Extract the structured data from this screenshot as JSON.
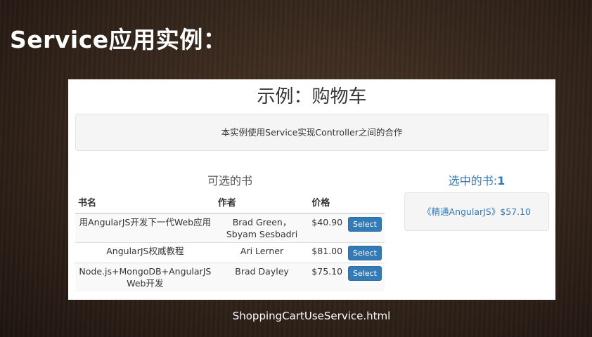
{
  "slide": {
    "title": "Service应用实例：",
    "caption": "ShoppingCartUseService.html"
  },
  "demo": {
    "title": "示例：购物车",
    "description": "本实例使用Service实现Controller之间的合作"
  },
  "available_books": {
    "title": "可选的书",
    "columns": [
      "书名",
      "作者",
      "价格"
    ],
    "button_label": "Select",
    "rows": [
      {
        "name": "用AngularJS开发下一代Web应用",
        "author": "Brad Green，Sbyam Sesbadri",
        "price": "$40.90"
      },
      {
        "name": "AngularJS权威教程",
        "author": "Ari Lerner",
        "price": "$81.00"
      },
      {
        "name": "Node.js+MongoDB+AngularJS Web开发",
        "author": "Brad Dayley",
        "price": "$75.10"
      }
    ]
  },
  "selected_books": {
    "title_prefix": "选中的书:",
    "count": "1",
    "items": [
      "《精通AngularJS》$57.10"
    ]
  },
  "colors": {
    "accent": "#337ab7",
    "background": "#3a2a1e"
  }
}
